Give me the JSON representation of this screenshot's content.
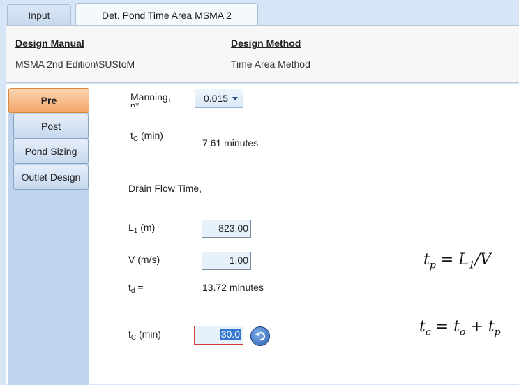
{
  "tabs": [
    {
      "label": "Input",
      "active": false
    },
    {
      "label": "Det. Pond Time Area MSMA 2",
      "active": true
    }
  ],
  "header": {
    "design_manual_title": "Design Manual",
    "design_manual_value": "MSMA 2nd Edition\\SUStoM",
    "design_method_title": "Design Method",
    "design_method_value": "Time Area Method"
  },
  "nav": [
    {
      "label": "Pre",
      "active": true
    },
    {
      "label": "Post"
    },
    {
      "label": "Pond Sizing"
    },
    {
      "label": "Outlet Design"
    }
  ],
  "form": {
    "manning_label": "Manning,",
    "manning_sub": "n*",
    "manning_value": "0.015",
    "tc1_label": "t",
    "tc1_sub": "C",
    "tc1_unit": " (min)",
    "tc1_value": "7.61 minutes",
    "drain_flow_label": "Drain Flow Time,",
    "l1_label": "L",
    "l1_sub": "1",
    "l1_unit": " (m)",
    "l1_value": "823.00",
    "v_label": "V (m/s)",
    "v_value": "1.00",
    "td_label": "t",
    "td_sub": "d",
    "td_unit": " =",
    "td_value": "13.72 minutes",
    "tc2_label": "t",
    "tc2_sub": "C",
    "tc2_unit": " (min)",
    "tc2_value": "30.0"
  },
  "formulas": {
    "tp": "t_p = L_1/V",
    "tc": "t_c = t_o + t_p"
  },
  "colors": {
    "active_nav": "#f4a66a",
    "input_bg": "#e6f1fb",
    "active_input_border": "#d43a3a"
  }
}
